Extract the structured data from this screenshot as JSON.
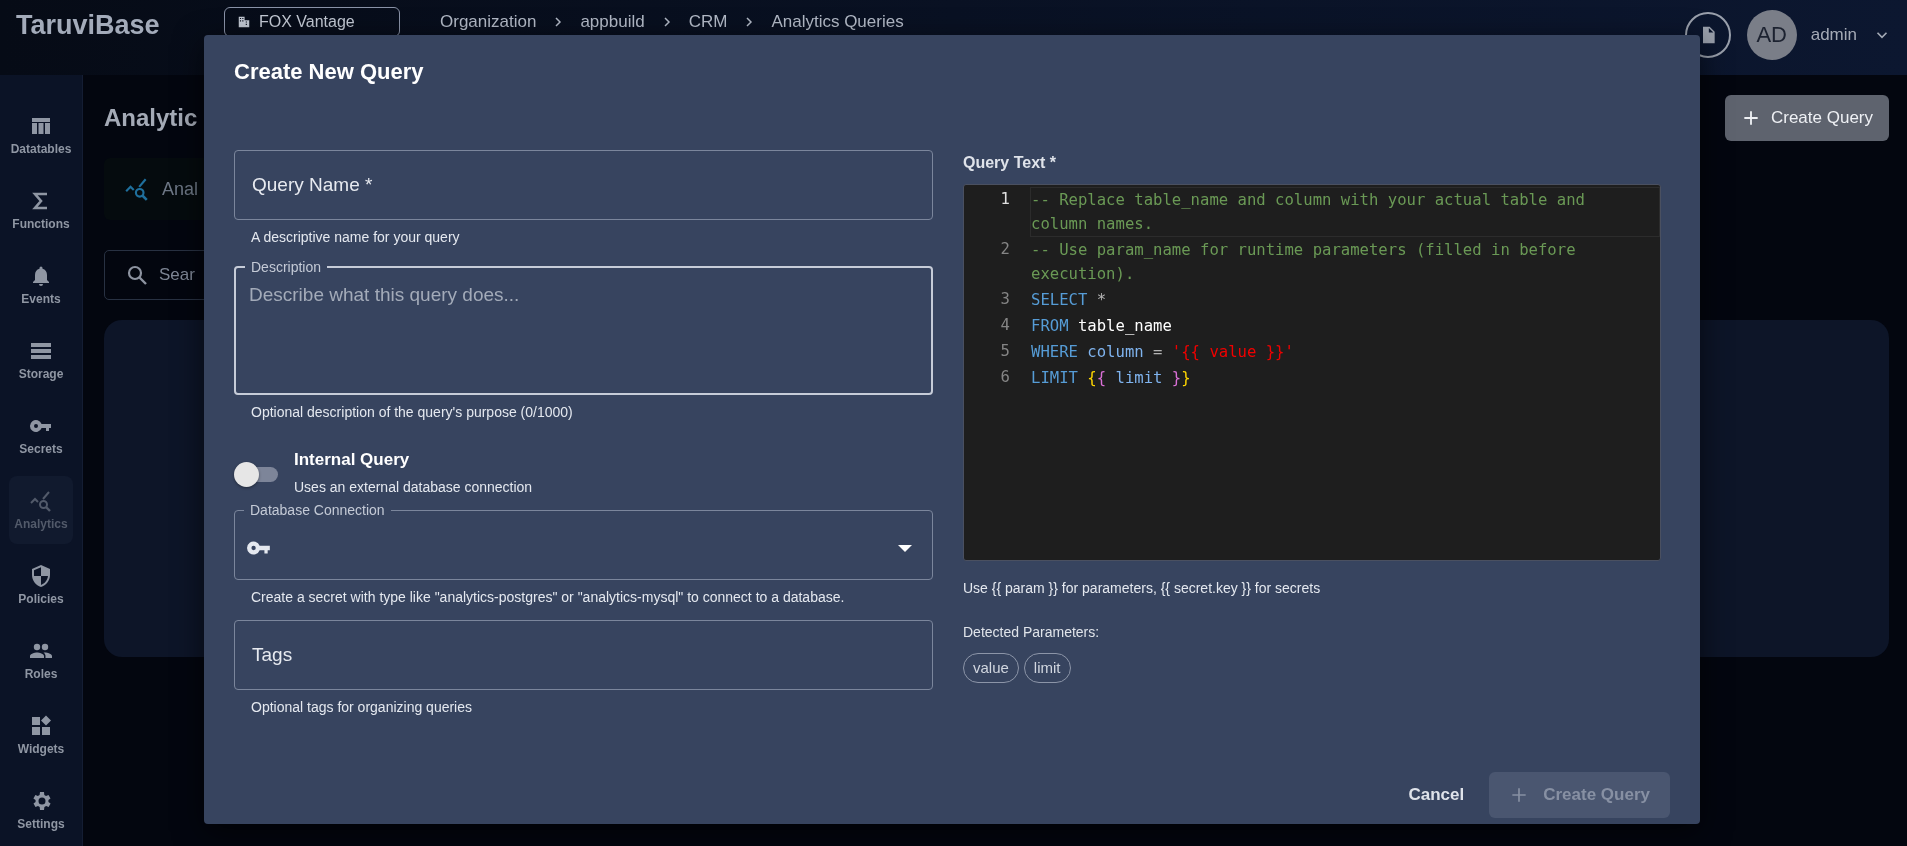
{
  "app": {
    "logo": "TaruviBase",
    "workspace": "FOX Vantage",
    "breadcrumb": [
      "Organization",
      "appbuild",
      "CRM",
      "Analytics Queries"
    ],
    "user": {
      "initials": "AD",
      "name": "admin"
    }
  },
  "sidebar": {
    "items": [
      {
        "label": "Datatables",
        "selected": false
      },
      {
        "label": "Functions",
        "selected": false
      },
      {
        "label": "Events",
        "selected": false
      },
      {
        "label": "Storage",
        "selected": false
      },
      {
        "label": "Secrets",
        "selected": false
      },
      {
        "label": "Analytics",
        "selected": true
      },
      {
        "label": "Policies",
        "selected": false
      },
      {
        "label": "Roles",
        "selected": false
      },
      {
        "label": "Widgets",
        "selected": false
      },
      {
        "label": "Settings",
        "selected": false
      }
    ]
  },
  "page": {
    "title": "Analytic",
    "header_button": "Create Query",
    "tab_label": "Anal",
    "search_placeholder": "Sear"
  },
  "dialog": {
    "title": "Create New Query",
    "query_name": {
      "placeholder": "Query Name *",
      "helper": "A descriptive name for your query"
    },
    "description": {
      "label": "Description",
      "placeholder": "Describe what this query does...",
      "helper": "Optional description of the query's purpose (0/1000)"
    },
    "internal_query": {
      "label": "Internal Query",
      "description": "Uses an external database connection",
      "on": false
    },
    "database_connection": {
      "label": "Database Connection",
      "helper": "Create a secret with type like \"analytics-postgres\" or \"analytics-mysql\" to connect to a database."
    },
    "tags": {
      "placeholder": "Tags",
      "helper": "Optional tags for organizing queries"
    },
    "query_text": {
      "label": "Query Text *",
      "lines": [
        {
          "number": "1",
          "current": true,
          "tokens": [
            {
              "kind": "comment",
              "text": "-- Replace table_name and column with your actual table and column names."
            }
          ]
        },
        {
          "number": "2",
          "current": false,
          "tokens": [
            {
              "kind": "comment",
              "text": "-- Use param_name for runtime parameters (filled in before execution)."
            }
          ]
        },
        {
          "number": "3",
          "current": false,
          "tokens": [
            {
              "kind": "keyword",
              "text": "SELECT"
            },
            {
              "kind": "operator",
              "text": " *"
            }
          ]
        },
        {
          "number": "4",
          "current": false,
          "tokens": [
            {
              "kind": "keyword",
              "text": "FROM"
            },
            {
              "kind": "plain",
              "text": " table_name"
            }
          ]
        },
        {
          "number": "5",
          "current": false,
          "tokens": [
            {
              "kind": "keyword",
              "text": "WHERE"
            },
            {
              "kind": "identifier",
              "text": " column"
            },
            {
              "kind": "operator",
              "text": " = "
            },
            {
              "kind": "string",
              "text": "'{{ value }}'"
            }
          ]
        },
        {
          "number": "6",
          "current": false,
          "tokens": [
            {
              "kind": "keyword",
              "text": "LIMIT "
            },
            {
              "kind": "bracket1",
              "text": "{"
            },
            {
              "kind": "bracket2",
              "text": "{"
            },
            {
              "kind": "identifier",
              "text": " limit "
            },
            {
              "kind": "bracket2",
              "text": "}"
            },
            {
              "kind": "bracket1",
              "text": "}"
            }
          ]
        }
      ],
      "helper": "Use {{ param }} for parameters, {{ secret.key }} for secrets"
    },
    "detected_parameters": {
      "label": "Detected Parameters:",
      "chips": [
        "value",
        "limit"
      ]
    },
    "buttons": [
      {
        "kind": "text",
        "label": "Cancel",
        "disabled": false
      },
      {
        "kind": "primary",
        "label": "Create Query",
        "disabled": true
      }
    ]
  }
}
